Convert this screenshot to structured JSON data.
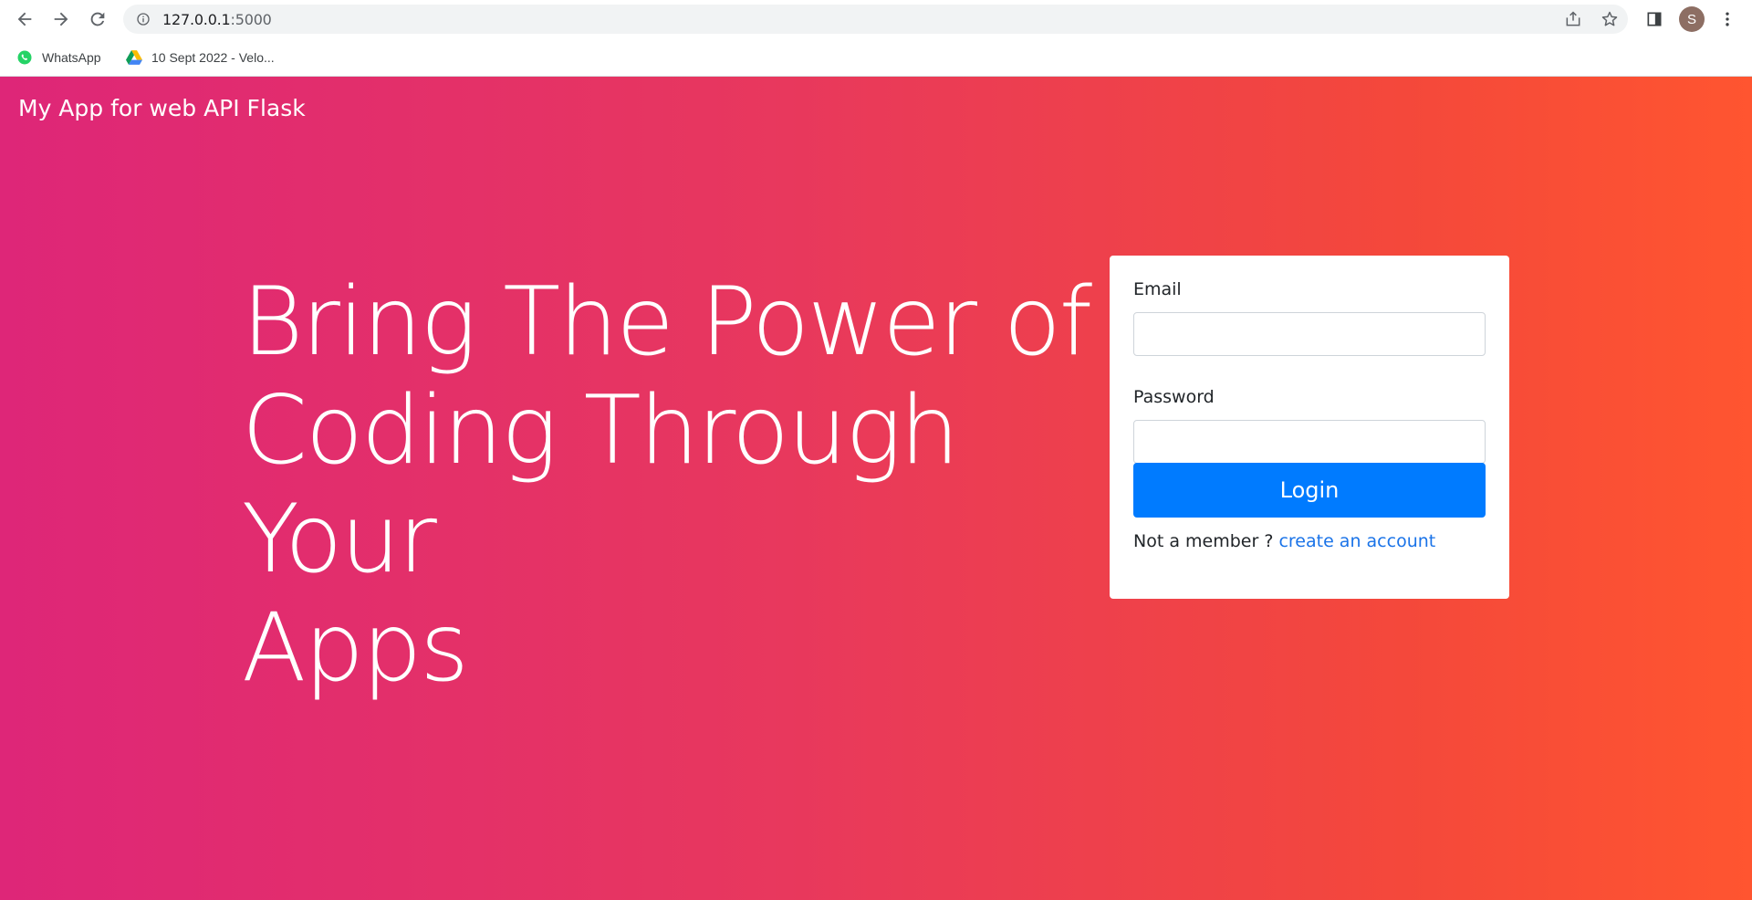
{
  "browser": {
    "url_host": "127.0.0.1",
    "url_port": ":5000",
    "profile_initial": "S",
    "icons": {
      "back": "arrow-left-icon",
      "forward": "arrow-right-icon",
      "reload": "reload-icon",
      "site_info": "info-icon",
      "share": "share-icon",
      "bookmark": "star-icon",
      "side_panel": "side-panel-icon",
      "menu": "kebab-menu-icon"
    }
  },
  "bookmarks": [
    {
      "label": "WhatsApp",
      "icon": "whatsapp-icon",
      "color": "#25d366"
    },
    {
      "label": "10 Sept 2022 - Velo...",
      "icon": "google-drive-icon"
    }
  ],
  "page": {
    "brand": "My App for web API Flask",
    "hero_lines": [
      "Bring The Power of",
      "Coding Through Your",
      "Apps"
    ],
    "gradient_colors": [
      "#de2678",
      "#ff5530"
    ],
    "form": {
      "email_label": "Email",
      "email_value": "",
      "password_label": "Password",
      "password_value": "",
      "login_label": "Login",
      "footer_text": "Not a member ? ",
      "signup_link": "create an account",
      "button_color": "#007bff",
      "link_color": "#1a73e8"
    }
  }
}
